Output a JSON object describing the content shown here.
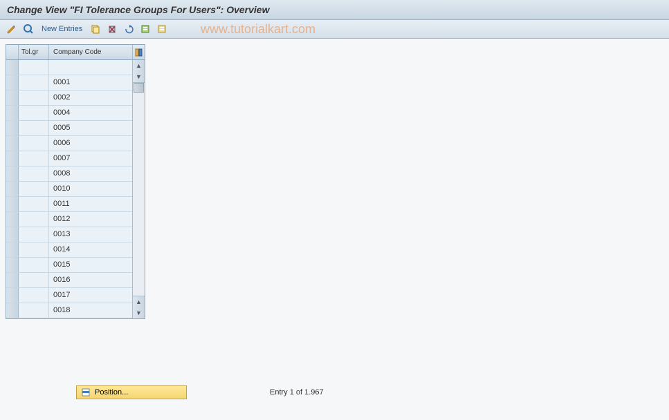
{
  "title": "Change View \"FI Tolerance Groups For Users\": Overview",
  "toolbar": {
    "new_entries": "New Entries"
  },
  "watermark": "www.tutorialkart.com",
  "table": {
    "col_tol": "Tol.gr",
    "col_cc": "Company Code",
    "rows": [
      {
        "tol": "",
        "cc": ""
      },
      {
        "tol": "",
        "cc": "0001"
      },
      {
        "tol": "",
        "cc": "0002"
      },
      {
        "tol": "",
        "cc": "0004"
      },
      {
        "tol": "",
        "cc": "0005"
      },
      {
        "tol": "",
        "cc": "0006"
      },
      {
        "tol": "",
        "cc": "0007"
      },
      {
        "tol": "",
        "cc": "0008"
      },
      {
        "tol": "",
        "cc": "0010"
      },
      {
        "tol": "",
        "cc": "0011"
      },
      {
        "tol": "",
        "cc": "0012"
      },
      {
        "tol": "",
        "cc": "0013"
      },
      {
        "tol": "",
        "cc": "0014"
      },
      {
        "tol": "",
        "cc": "0015"
      },
      {
        "tol": "",
        "cc": "0016"
      },
      {
        "tol": "",
        "cc": "0017"
      },
      {
        "tol": "",
        "cc": "0018"
      }
    ]
  },
  "footer": {
    "position_label": "Position...",
    "entry_text": "Entry 1 of 1.967"
  }
}
